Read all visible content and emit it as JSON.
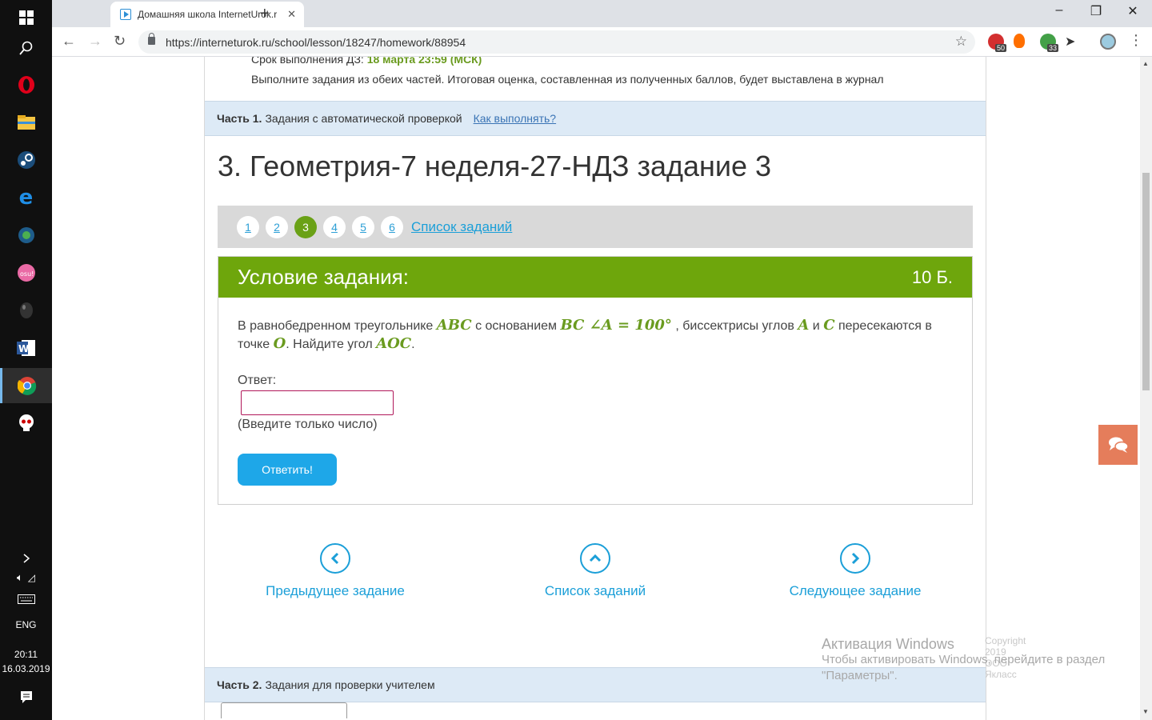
{
  "taskbar": {
    "language": "ENG",
    "time": "20:11",
    "date": "16.03.2019"
  },
  "browser": {
    "tab_title": "Домашняя школа InternetUrok.r",
    "url": "https://interneturok.ru/school/lesson/18247/homework/88954",
    "ext_badges": [
      "50",
      "33"
    ]
  },
  "header": {
    "deadline_label": "Срок выполнения ДЗ:",
    "deadline_value": "18 марта 23:59 (МСК)",
    "instructions": "Выполните задания из обеих частей. Итоговая оценка, составленная из полученных баллов, будет выставлена в журнал"
  },
  "part1": {
    "label": "Часть 1.",
    "text": "Задания с автоматической проверкой",
    "help_link": "Как выполнять?"
  },
  "task": {
    "title": "3. Геометрия-7 неделя-27-НДЗ задание 3",
    "pages": [
      "1",
      "2",
      "3",
      "4",
      "5",
      "6"
    ],
    "current_page": "3",
    "list_link": "Список заданий"
  },
  "condition": {
    "header": "Условие задания:",
    "points": "10 Б.",
    "t1": "В равнобедренном треугольнике",
    "m1": "ABC",
    "t2": "с основанием",
    "m2": "BC ∠A = 100°",
    "t3": ", биссектрисы углов",
    "m3": "A",
    "t4": "и",
    "m4": "C",
    "t5": "пересекаются в точке",
    "m5": "O",
    "t6": ". Найдите угол",
    "m6": "AOC",
    "t7": ".",
    "answer_label": "Ответ:",
    "answer_value": "",
    "answer_hint": "(Введите только число)",
    "submit_label": "Ответить!"
  },
  "navigation": {
    "prev": "Предыдущее задание",
    "list": "Список заданий",
    "next": "Следующее задание"
  },
  "part2": {
    "label": "Часть 2.",
    "text": "Задания для проверки учителем"
  },
  "watermark": {
    "title": "Активация Windows",
    "line1": "Чтобы активировать Windows, перейдите в раздел",
    "line2": "\"Параметры\".",
    "copyright": "Copyright 2019 ООО Якласс"
  }
}
